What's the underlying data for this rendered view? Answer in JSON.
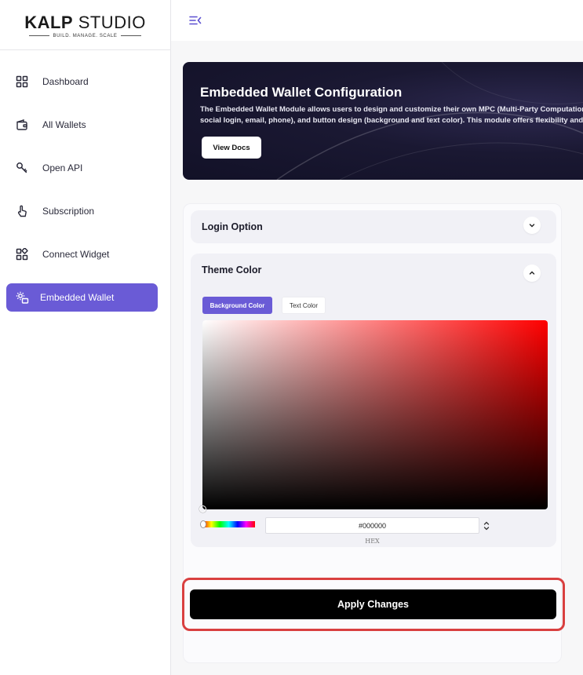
{
  "brand": {
    "name_bold": "KALP",
    "name_light": " STUDIO",
    "tagline": "BUILD. MANAGE. SCALE"
  },
  "sidebar": {
    "items": [
      {
        "label": "Dashboard",
        "icon": "grid-icon"
      },
      {
        "label": "All Wallets",
        "icon": "wallet-icon"
      },
      {
        "label": "Open API",
        "icon": "key-icon"
      },
      {
        "label": "Subscription",
        "icon": "pointer-hand-icon"
      },
      {
        "label": "Connect Widget",
        "icon": "widget-icon"
      },
      {
        "label": "Embedded Wallet",
        "icon": "gear-wallet-icon",
        "active": true
      }
    ]
  },
  "banner": {
    "title": "Embedded Wallet Configuration",
    "desc_line1": "The Embedded Wallet Module allows users to design and customize their own MPC (Multi-Party Computation) wa",
    "desc_line2": "social login, email, phone), and button design (background and text color). This module offers flexibility and sec",
    "button_label": "View Docs"
  },
  "accordions": {
    "login": {
      "title": "Login Option",
      "expanded": false
    },
    "theme": {
      "title": "Theme Color",
      "expanded": true
    }
  },
  "theme_tabs": {
    "background": "Background Color",
    "text": "Text Color",
    "active": "background"
  },
  "color_picker": {
    "hex_value": "#000000",
    "hex_label": "HEX",
    "hue_color": "#ff0000"
  },
  "actions": {
    "apply_label": "Apply Changes"
  },
  "colors": {
    "accent": "#6a5bd6",
    "highlight_border": "#d94040"
  }
}
